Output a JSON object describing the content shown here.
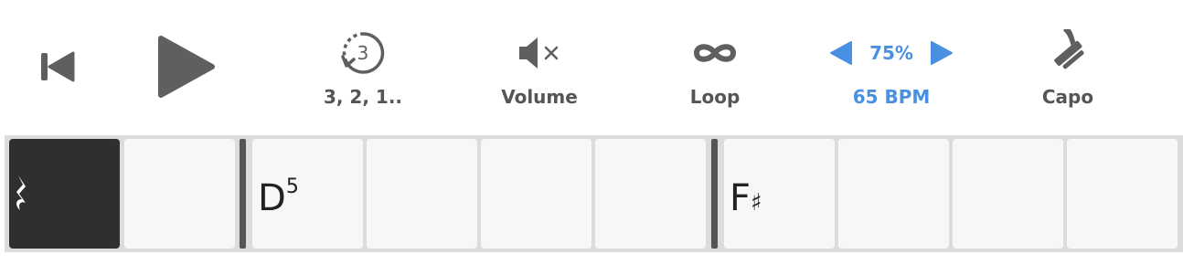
{
  "toolbar": {
    "skip_back": {
      "icon": "skip-back-icon"
    },
    "play": {
      "icon": "play-icon"
    },
    "countin": {
      "icon": "countdown-icon",
      "icon_number": "3",
      "label": "3, 2, 1.."
    },
    "volume": {
      "icon": "muted-speaker-icon",
      "label": "Volume"
    },
    "loop": {
      "icon": "infinity-icon",
      "label": "Loop"
    },
    "tempo": {
      "percent": "75%",
      "bpm_label": "65 BPM"
    },
    "capo": {
      "icon": "capo-icon",
      "label": "Capo"
    }
  },
  "colors": {
    "accent": "#4a90e2",
    "icon_gray": "#5f5f5f",
    "active_cell": "#2f2f2f"
  },
  "measures": [
    {
      "beats": [
        {
          "type": "rest",
          "active": true
        },
        {
          "type": "empty"
        }
      ]
    },
    {
      "beats": [
        {
          "type": "chord",
          "root": "D",
          "superscript": "5"
        },
        {
          "type": "empty"
        },
        {
          "type": "empty"
        },
        {
          "type": "empty"
        }
      ]
    },
    {
      "beats": [
        {
          "type": "chord",
          "root": "F",
          "accidental": "♯"
        },
        {
          "type": "empty"
        },
        {
          "type": "empty"
        },
        {
          "type": "empty"
        }
      ]
    }
  ]
}
